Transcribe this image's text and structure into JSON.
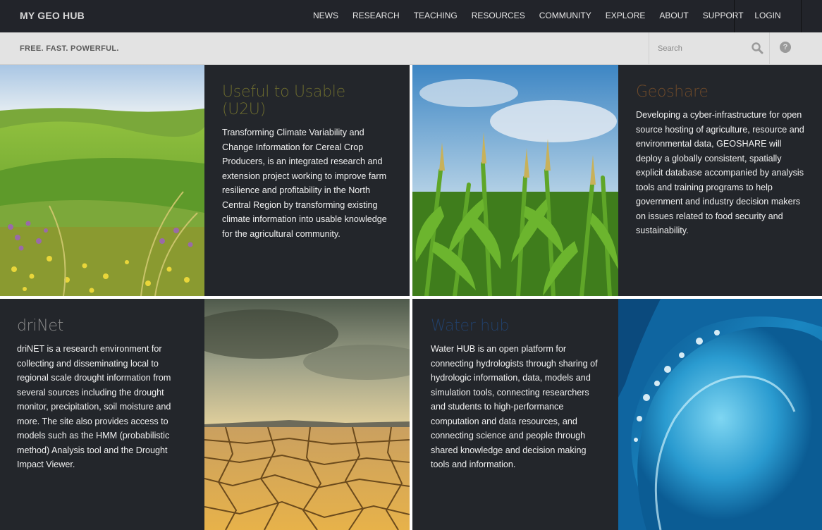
{
  "header": {
    "logo": "MY GEO HUB",
    "nav": [
      "NEWS",
      "RESEARCH",
      "TEACHING",
      "RESOURCES",
      "COMMUNITY",
      "EXPLORE",
      "ABOUT",
      "SUPPORT"
    ],
    "login": "LOGIN"
  },
  "subbar": {
    "tagline": "FREE. FAST. POWERFUL.",
    "search_placeholder": "Search",
    "help": "?"
  },
  "cards": [
    {
      "title": "Useful to Usable (U2U)",
      "title_color": "#6b6a2e",
      "text": "Transforming Climate Variability and Change Information for Cereal Crop Producers, is an integrated research and extension project working to improve farm resilience and profitability in the North Central Region by transforming existing climate information into usable knowledge for the agricultural community.",
      "image": "green-hills-field-image"
    },
    {
      "title": "Geoshare",
      "title_color": "#6e4a2a",
      "text": "Developing a cyber-infrastructure for open source hosting of agriculture, resource and environmental data, GEOSHARE will deploy a globally consistent, spatially explicit database accompanied by analysis tools and training programs to help government and industry decision makers on issues related to food security and sustainability.",
      "image": "corn-field-image"
    },
    {
      "title": "driNet",
      "title_color": "#8a8a8a",
      "text": "driNET is a research environment for collecting and disseminating local to regional scale drought information from several sources including the drought monitor, precipitation, soil moisture and more. The site also provides access to models such as the HMM (probabilistic method) Analysis tool and the Drought Impact Viewer.",
      "image": "cracked-desert-image"
    },
    {
      "title": "Water hub",
      "title_color": "#22406a",
      "text": "Water HUB is an open platform for connecting hydrologists through sharing of hydrologic information, data, models and simulation tools, connecting researchers and students to high-performance computation and data resources, and connecting science and people through shared knowledge and decision making tools and information.",
      "image": "ocean-wave-image"
    }
  ]
}
